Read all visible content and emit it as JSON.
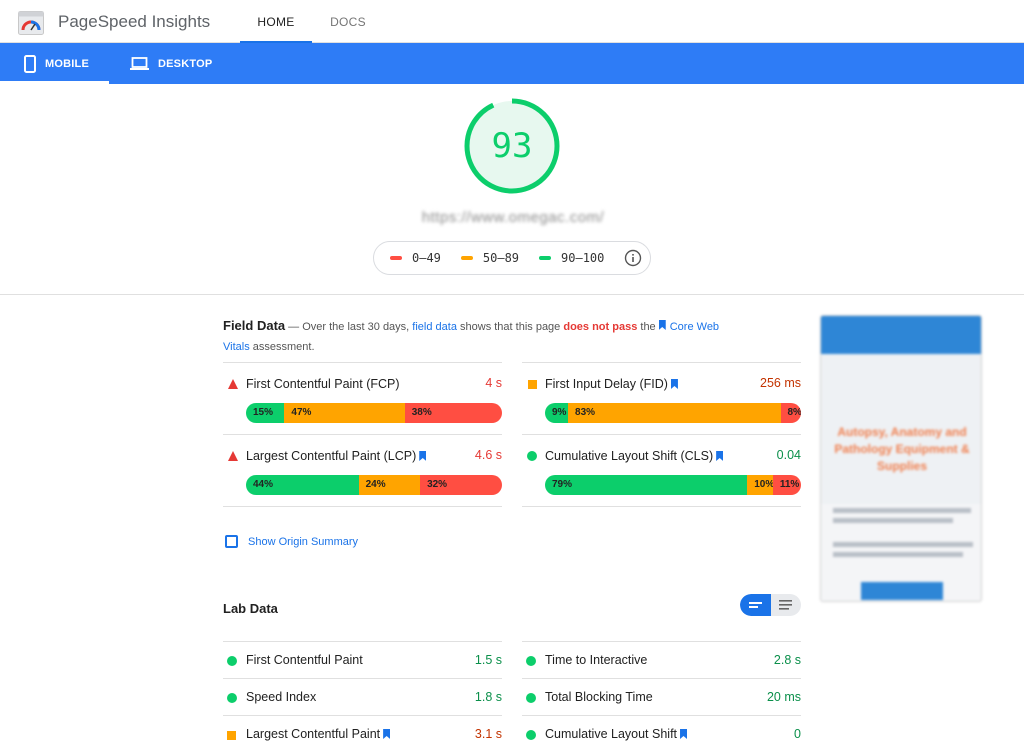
{
  "header": {
    "app_title": "PageSpeed Insights",
    "tabs": [
      {
        "label": "HOME",
        "active": true
      },
      {
        "label": "DOCS",
        "active": false
      }
    ]
  },
  "device_tabs": [
    {
      "label": "MOBILE",
      "icon": "phone-icon",
      "active": true
    },
    {
      "label": "DESKTOP",
      "icon": "laptop-icon",
      "active": false
    }
  ],
  "score": {
    "value": "93",
    "fraction": 0.93,
    "color": "#0cce6b",
    "url": "https://www.omegac.com/"
  },
  "legend": [
    {
      "label": "0–49",
      "color": "#ff4e42"
    },
    {
      "label": "50–89",
      "color": "#ffa400"
    },
    {
      "label": "90–100",
      "color": "#0cce6b"
    }
  ],
  "field_data": {
    "title": "Field Data",
    "desc_parts": {
      "p1": " — Over the last 30 days, ",
      "link1": "field data",
      "p2": " shows that this page ",
      "fail": "does not pass",
      "p3": " the ",
      "link2": "Core Web Vitals",
      "p4": " assessment."
    },
    "metrics": [
      {
        "name": "First Contentful Paint (FCP)",
        "value": "4 s",
        "status": "red",
        "core": false,
        "dist": [
          {
            "pct": 15,
            "label": "15%"
          },
          {
            "pct": 47,
            "label": "47%"
          },
          {
            "pct": 38,
            "label": "38%"
          }
        ]
      },
      {
        "name": "First Input Delay (FID)",
        "value": "256 ms",
        "status": "orange",
        "core": true,
        "dist": [
          {
            "pct": 9,
            "label": "9%"
          },
          {
            "pct": 83,
            "label": "83%"
          },
          {
            "pct": 8,
            "label": "8%"
          }
        ]
      },
      {
        "name": "Largest Contentful Paint (LCP)",
        "value": "4.6 s",
        "status": "red",
        "core": true,
        "dist": [
          {
            "pct": 44,
            "label": "44%"
          },
          {
            "pct": 24,
            "label": "24%"
          },
          {
            "pct": 32,
            "label": "32%"
          }
        ]
      },
      {
        "name": "Cumulative Layout Shift (CLS)",
        "value": "0.04",
        "status": "green",
        "core": true,
        "dist": [
          {
            "pct": 79,
            "label": "79%"
          },
          {
            "pct": 10,
            "label": "10%"
          },
          {
            "pct": 11,
            "label": "11%"
          }
        ]
      }
    ],
    "origin_summary": "Show Origin Summary"
  },
  "lab_data": {
    "title": "Lab Data",
    "metrics": [
      {
        "name": "First Contentful Paint",
        "value": "1.5 s",
        "status": "green",
        "core": false
      },
      {
        "name": "Time to Interactive",
        "value": "2.8 s",
        "status": "green",
        "core": false
      },
      {
        "name": "Speed Index",
        "value": "1.8 s",
        "status": "green",
        "core": false
      },
      {
        "name": "Total Blocking Time",
        "value": "20 ms",
        "status": "green",
        "core": false
      },
      {
        "name": "Largest Contentful Paint",
        "value": "3.1 s",
        "status": "orange",
        "core": true
      },
      {
        "name": "Cumulative Layout Shift",
        "value": "0",
        "status": "green",
        "core": true
      }
    ]
  },
  "thumbnail": {
    "heading": "Autopsy, Anatomy and Pathology Equipment & Supplies"
  }
}
